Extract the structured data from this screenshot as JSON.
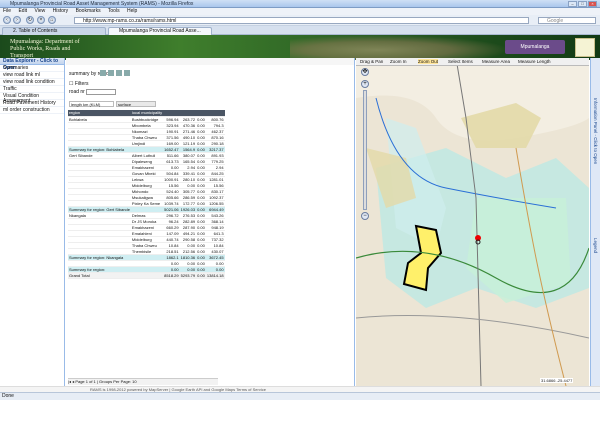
{
  "window": {
    "title": "Mpumalanga Provincial Road Asset Management System (RAMS) - Mozilla Firefox"
  },
  "menu": [
    "File",
    "Edit",
    "View",
    "History",
    "Bookmarks",
    "Tools",
    "Help"
  ],
  "nav": {
    "url": "http://www.mp-rams.co.za/rams/rams.html",
    "search_placeholder": "Google"
  },
  "tabs": [
    {
      "label": "2. Table of Contents"
    },
    {
      "label": "Mpumalanga Provincial Road Asse..."
    }
  ],
  "banner": {
    "line1": "Mpumalanga: Department of",
    "line2": "Public Works, Roads and",
    "line3": "Transport",
    "right_logo": "Mpumalanga"
  },
  "left_panel": {
    "header": "Data Explorer - Click to Open",
    "items": [
      "Summaries",
      "view road link ml",
      "view road link condition",
      "Traffic",
      "Visual Condition Assessment",
      "Road Pavement History",
      "ml order construction"
    ]
  },
  "summary": {
    "label": "summary by region",
    "filters_label": "Filters",
    "road_label": "road nr",
    "length_label": "length km (KLM)",
    "surface_label": "surface",
    "columns": [
      "region",
      "local municipality",
      "",
      "",
      "",
      ""
    ]
  },
  "table": {
    "rows": [
      {
        "region": "Bohlabela",
        "muni": "Bushbuckridge",
        "v1": "596.94",
        "v2": "263.72",
        "v3": "0.00",
        "v4": "800.76",
        "type": "row"
      },
      {
        "region": "",
        "muni": "Mbombela",
        "v1": "323.94",
        "v2": "470.36",
        "v3": "0.00",
        "v4": "794.3",
        "type": "row"
      },
      {
        "region": "",
        "muni": "Nkomazi",
        "v1": "190.91",
        "v2": "271.46",
        "v3": "0.00",
        "v4": "462.37",
        "type": "row"
      },
      {
        "region": "",
        "muni": "Thaba Chweu",
        "v1": "371.56",
        "v2": "490.10",
        "v3": "0.00",
        "v4": "870.16",
        "type": "row"
      },
      {
        "region": "",
        "muni": "Umjindi",
        "v1": "169.00",
        "v2": "121.19",
        "v3": "0.00",
        "v4": "290.18",
        "type": "row"
      },
      {
        "region": "Summary for region: Bohlabela",
        "muni": "",
        "v1": "1652.47",
        "v2": "1564.9",
        "v3": "0.00",
        "v4": "3217.37",
        "type": "sum"
      },
      {
        "region": "Gert Sibande",
        "muni": "Albert Luthuli",
        "v1": "511.66",
        "v2": "380.07",
        "v3": "0.00",
        "v4": "891.93",
        "type": "row"
      },
      {
        "region": "",
        "muni": "Dipaleseng",
        "v1": "613.73",
        "v2": "165.54",
        "v3": "0.00",
        "v4": "779.25",
        "type": "row"
      },
      {
        "region": "",
        "muni": "Emakhazeni",
        "v1": "0.00",
        "v2": "2.94",
        "v3": "0.00",
        "v4": "2.94",
        "type": "row"
      },
      {
        "region": "",
        "muni": "Govan Mbeki",
        "v1": "504.84",
        "v2": "339.41",
        "v3": "0.00",
        "v4": "844.25",
        "type": "row"
      },
      {
        "region": "",
        "muni": "Lekwa",
        "v1": "1000.91",
        "v2": "280.10",
        "v3": "0.00",
        "v4": "1281.01",
        "type": "row"
      },
      {
        "region": "",
        "muni": "Middelburg",
        "v1": "15.56",
        "v2": "0.00",
        "v3": "0.00",
        "v4": "15.56",
        "type": "row"
      },
      {
        "region": "",
        "muni": "Mkhondo",
        "v1": "524.40",
        "v2": "305.77",
        "v3": "0.00",
        "v4": "830.17",
        "type": "row"
      },
      {
        "region": "",
        "muni": "Msukaligwa",
        "v1": "805.66",
        "v2": "286.59",
        "v3": "0.00",
        "v4": "1092.37",
        "type": "row"
      },
      {
        "region": "",
        "muni": "Pixley Ka Seme",
        "v1": "1039.74",
        "v2": "172.77",
        "v3": "0.00",
        "v4": "1206.55",
        "type": "row"
      },
      {
        "region": "Summary for region: Gert Sibande",
        "muni": "",
        "v1": "5021.06",
        "v2": "1926.03",
        "v3": "0.00",
        "v4": "6944.49",
        "type": "sum"
      },
      {
        "region": "Nkangala",
        "muni": "Delmas",
        "v1": "296.72",
        "v2": "276.53",
        "v3": "0.00",
        "v4": "543.26",
        "type": "row"
      },
      {
        "region": "",
        "muni": "Dr JS Moroka",
        "v1": "96.24",
        "v2": "282.89",
        "v3": "0.00",
        "v4": "368.14",
        "type": "row"
      },
      {
        "region": "",
        "muni": "Emakhazeni",
        "v1": "660.29",
        "v2": "287.90",
        "v3": "0.00",
        "v4": "948.19",
        "type": "row"
      },
      {
        "region": "",
        "muni": "Emalahleni",
        "v1": "147.09",
        "v2": "494.21",
        "v3": "0.00",
        "v4": "641.3",
        "type": "row"
      },
      {
        "region": "",
        "muni": "Middelburg",
        "v1": "440.74",
        "v2": "290.58",
        "v3": "0.00",
        "v4": "737.32",
        "type": "row"
      },
      {
        "region": "",
        "muni": "Thaba Chweu",
        "v1": "10.84",
        "v2": "0.00",
        "v3": "0.00",
        "v4": "10.84",
        "type": "row"
      },
      {
        "region": "",
        "muni": "Thembisile",
        "v1": "218.51",
        "v2": "212.56",
        "v3": "0.00",
        "v4": "430.07",
        "type": "row"
      },
      {
        "region": "Summary for region: Nkangala",
        "muni": "",
        "v1": "1862.1",
        "v2": "1810.36",
        "v3": "0.00",
        "v4": "3672.45",
        "type": "sum"
      },
      {
        "region": "",
        "muni": "",
        "v1": "0.00",
        "v2": "0.00",
        "v3": "0.00",
        "v4": "0.00",
        "type": "row"
      },
      {
        "region": "Summary for region:",
        "muni": "",
        "v1": "0.00",
        "v2": "0.00",
        "v3": "0.00",
        "v4": "0.00",
        "type": "sum"
      },
      {
        "region": "Grand Total",
        "muni": "",
        "v1": "8518.29",
        "v2": "5293.79",
        "v3": "0.00",
        "v4": "13814.18",
        "type": "grand"
      }
    ]
  },
  "pager": {
    "text": "Page 1 of 1 | Groups Per Page: 10"
  },
  "map": {
    "toolbar": [
      "Drag & Pan",
      "Zoom In",
      "Zoom Out",
      "Select Items",
      "Measure Area",
      "Measure Length"
    ],
    "coords": "31.6866 -25.4477"
  },
  "right_strip": [
    "Information Panel - Click to Open",
    "Legend"
  ],
  "footer": "RAMS is 1998-2012 powered by MapServer | Google Earth API and Google Maps Terms of Service",
  "status": "Done"
}
